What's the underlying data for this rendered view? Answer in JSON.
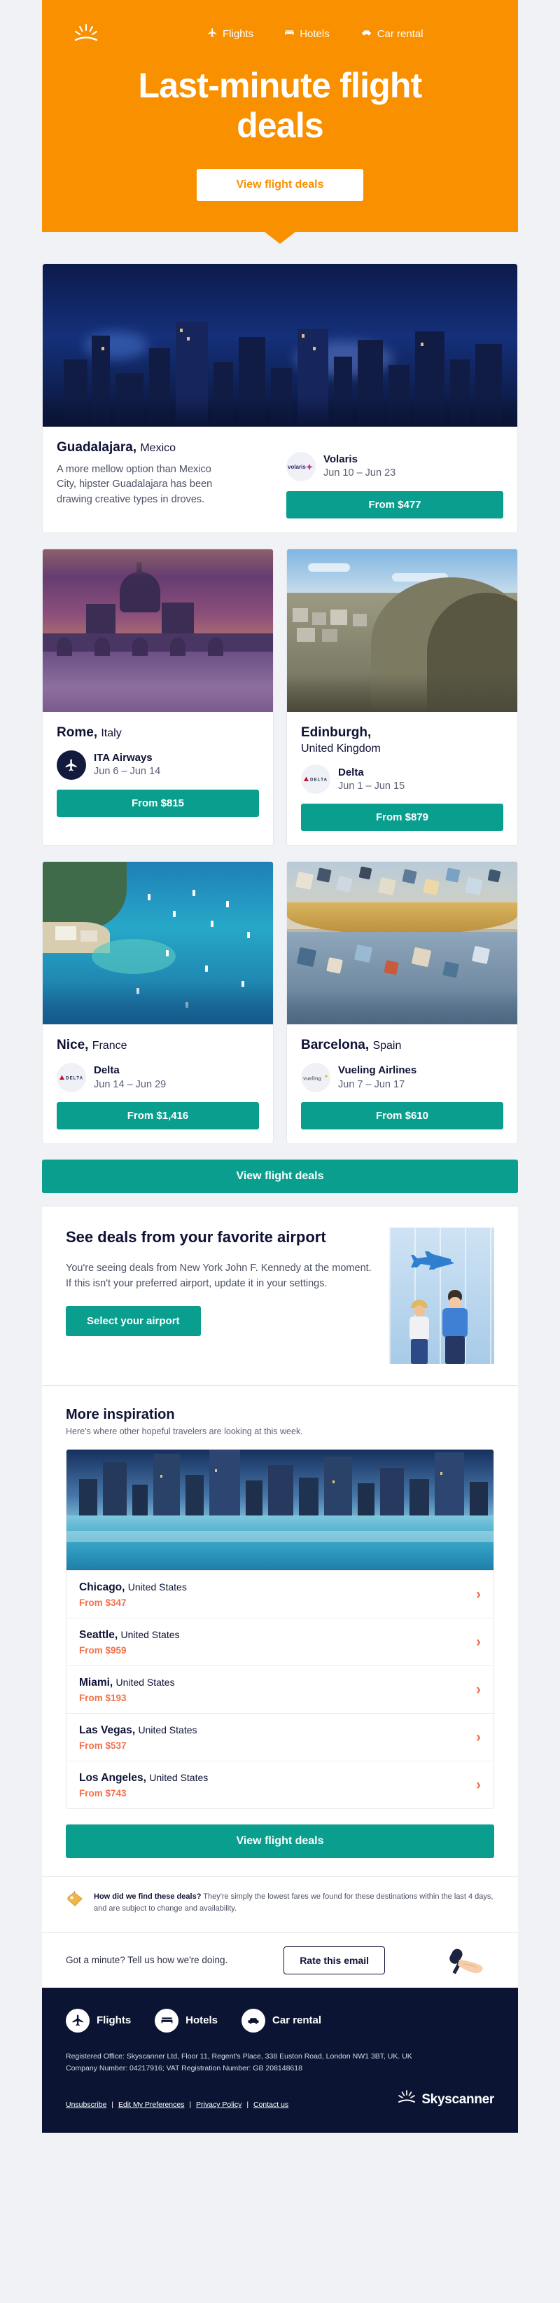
{
  "brand": {
    "name": "Skyscanner",
    "accent_orange": "#f89000",
    "accent_teal": "#0a9e8e",
    "accent_coral": "#f4704a",
    "navy": "#0b1533"
  },
  "header": {
    "logo_name": "skyscanner-sunburst-logo",
    "nav": [
      {
        "label": "Flights",
        "icon": "plane-icon"
      },
      {
        "label": "Hotels",
        "icon": "bed-icon"
      },
      {
        "label": "Car rental",
        "icon": "car-icon"
      }
    ],
    "title": "Last-minute flight deals",
    "cta_label": "View flight deals"
  },
  "featured_deal": {
    "city": "Guadalajara,",
    "country": "Mexico",
    "description": "A more mellow option than Mexico City, hipster Guadalajara has been drawing creative types in droves.",
    "airline": "Volaris",
    "airline_logo": "volaris-logo",
    "dates": "Jun 10 – Jun 23",
    "price_label": "From $477",
    "photo": "guadalajara-skyline-night"
  },
  "deals": [
    {
      "city": "Rome,",
      "country": "Italy",
      "airline": "ITA Airways",
      "airline_logo": "ita-airways-logo",
      "dates": "Jun 6 – Jun 14",
      "price_label": "From $815",
      "photo": "rome-st-peters-dusk"
    },
    {
      "city": "Edinburgh,",
      "country": "United Kingdom",
      "airline": "Delta",
      "airline_logo": "delta-logo",
      "dates": "Jun 1 – Jun 15",
      "price_label": "From $879",
      "photo": "edinburgh-arthurs-seat"
    },
    {
      "city": "Nice,",
      "country": "France",
      "airline": "Delta",
      "airline_logo": "delta-logo",
      "dates": "Jun 14 – Jun 29",
      "price_label": "From $1,416",
      "photo": "nice-bay-boats"
    },
    {
      "city": "Barcelona,",
      "country": "Spain",
      "airline": "Vueling Airlines",
      "airline_logo": "vueling-logo",
      "dates": "Jun 7 – Jun 17",
      "price_label": "From $610",
      "photo": "barcelona-park-guell-mosaic"
    }
  ],
  "mid_cta_label": "View flight deals",
  "airport_section": {
    "heading": "See deals from your favorite airport",
    "body": "You're seeing deals from New York John F. Kennedy at the moment. If this isn't your preferred airport, update it in your settings.",
    "button_label": "Select your airport",
    "art": "airport-travellers-illustration"
  },
  "inspiration": {
    "heading": "More inspiration",
    "subheading": "Here's where other hopeful travelers are looking at this week.",
    "photo": "chicago-skyline-waterfront",
    "rows": [
      {
        "city": "Chicago,",
        "country": "United States",
        "price": "From $347"
      },
      {
        "city": "Seattle,",
        "country": "United States",
        "price": "From $959"
      },
      {
        "city": "Miami,",
        "country": "United States",
        "price": "From $193"
      },
      {
        "city": "Las Vegas,",
        "country": "United States",
        "price": "From $537"
      },
      {
        "city": "Los Angeles,",
        "country": "United States",
        "price": "From $743"
      }
    ],
    "cta_label": "View flight deals"
  },
  "disclaimer": {
    "icon": "price-tag-icon",
    "lead": "How did we find these deals?",
    "text": " They're simply the lowest fares we found for these destinations within the last 4 days, and are subject to change and availability."
  },
  "rate": {
    "text": "Got a minute? Tell us how we're doing.",
    "button_label": "Rate this email",
    "art": "hand-holding-microphone"
  },
  "footer": {
    "nav": [
      {
        "label": "Flights",
        "icon": "plane-icon"
      },
      {
        "label": "Hotels",
        "icon": "bed-icon"
      },
      {
        "label": "Car rental",
        "icon": "car-icon"
      }
    ],
    "legal_line1": "Registered Office: Skyscanner Ltd, Floor 11, Regent's Place, 338 Euston Road, London NW1 3BT, UK. UK",
    "legal_line2": "Company Number: 04217916; VAT Registration Number: GB 208148618",
    "links": [
      {
        "label": "Unsubscribe"
      },
      {
        "label": "Edit My Preferences"
      },
      {
        "label": "Privacy Policy"
      },
      {
        "label": "Contact us"
      }
    ],
    "logo_text": "Skyscanner",
    "logo_icon": "skyscanner-sunburst-logo"
  }
}
